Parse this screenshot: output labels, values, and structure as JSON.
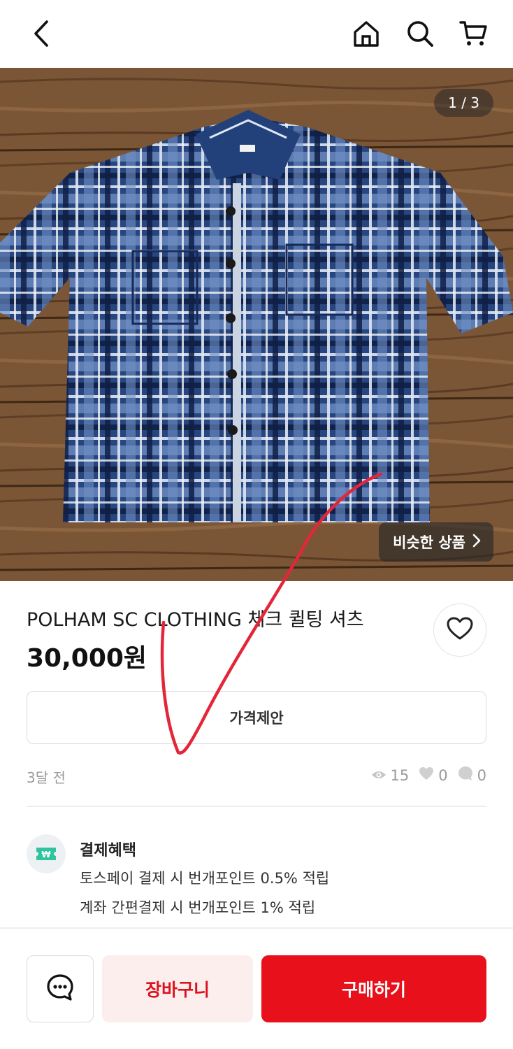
{
  "header": {
    "back_icon": "chevron-left-icon",
    "home_icon": "home-icon",
    "search_icon": "search-icon",
    "cart_icon": "cart-icon"
  },
  "gallery": {
    "counter": "1 / 3",
    "similar_label": "비슷한 상품"
  },
  "product": {
    "title": "POLHAM SC CLOTHING 체크 퀼팅 셔츠",
    "price": "30,000원",
    "offer_label": "가격제안",
    "posted": "3달 전",
    "views": "15",
    "likes": "0",
    "chats": "0"
  },
  "benefits": {
    "title": "결제혜택",
    "line1": "토스페이 결제 시 번개포인트 0.5% 적립",
    "line2": "계좌 간편결제 시 번개포인트 1% 적립"
  },
  "actions": {
    "cart_label": "장바구니",
    "buy_label": "구매하기"
  },
  "colors": {
    "accent": "#e8101a",
    "cart_bg": "#fdeeee",
    "cart_text": "#d9141e",
    "benefit_icon": "#2ec4a0"
  }
}
